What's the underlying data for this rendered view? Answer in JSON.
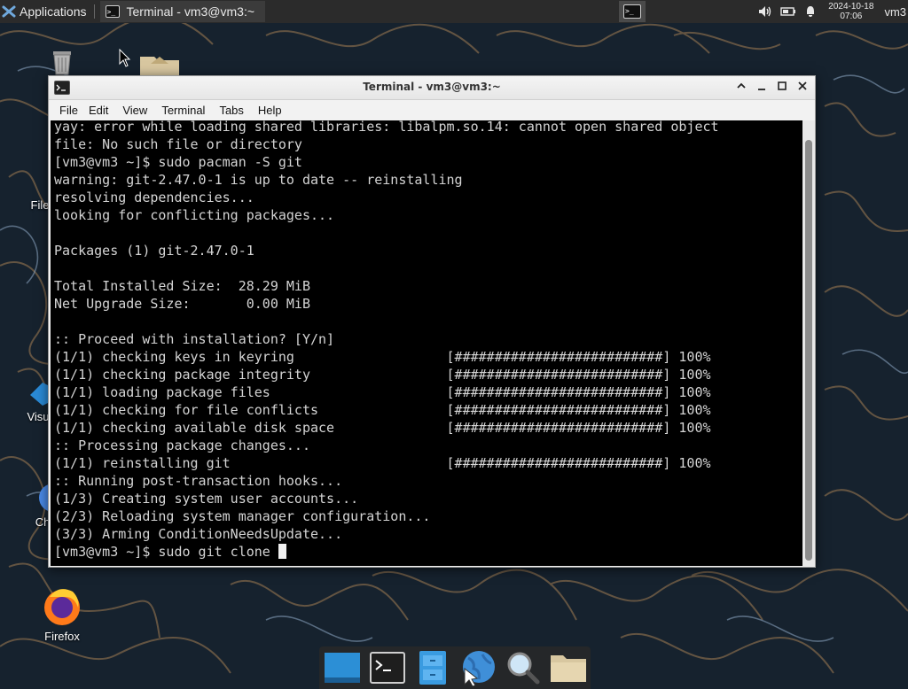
{
  "top_panel": {
    "apps_label": "Applications",
    "task_title": "Terminal - vm3@vm3:~",
    "clock_date": "2024-10-18",
    "clock_time": "07:06",
    "user": "vm3"
  },
  "desktop": {
    "icons": [
      {
        "label": "File",
        "icon": "filesystem-icon"
      },
      {
        "label": "Visu",
        "icon": "vscode-icon"
      },
      {
        "label": "Ch",
        "icon": "chrome-icon"
      },
      {
        "label": "Firefox",
        "icon": "firefox-icon"
      }
    ]
  },
  "window": {
    "title": "Terminal - vm3@vm3:~",
    "menu": [
      "File",
      "Edit",
      "View",
      "Terminal",
      "Tabs",
      "Help"
    ],
    "lines": [
      "yay: error while loading shared libraries: libalpm.so.14: cannot open shared object",
      "file: No such file or directory",
      "[vm3@vm3 ~]$ sudo pacman -S git",
      "warning: git-2.47.0-1 is up to date -- reinstalling",
      "resolving dependencies...",
      "looking for conflicting packages...",
      "",
      "Packages (1) git-2.47.0-1",
      "",
      "Total Installed Size:  28.29 MiB",
      "Net Upgrade Size:       0.00 MiB",
      "",
      ":: Proceed with installation? [Y/n]",
      "(1/1) checking keys in keyring                   [##########################] 100%",
      "(1/1) checking package integrity                 [##########################] 100%",
      "(1/1) loading package files                      [##########################] 100%",
      "(1/1) checking for file conflicts                [##########################] 100%",
      "(1/1) checking available disk space              [##########################] 100%",
      ":: Processing package changes...",
      "(1/1) reinstalling git                           [##########################] 100%",
      ":: Running post-transaction hooks...",
      "(1/3) Creating system user accounts...",
      "(2/3) Reloading system manager configuration...",
      "(3/3) Arming ConditionNeedsUpdate..."
    ],
    "prompt": "[vm3@vm3 ~]$ sudo git clone "
  },
  "dock": {
    "items": [
      "show-desktop-icon",
      "terminal-icon",
      "file-manager-icon",
      "web-browser-icon",
      "app-finder-icon",
      "home-folder-icon"
    ]
  },
  "colors": {
    "terminal_bg": "#000000",
    "terminal_fg": "#d4d4d4",
    "panel_bg": "#2b2b2b"
  }
}
